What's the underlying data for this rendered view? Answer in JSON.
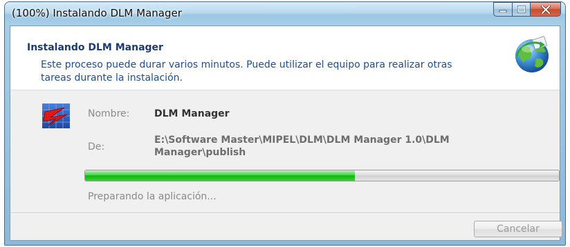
{
  "window": {
    "title": "(100%) Instalando DLM Manager"
  },
  "header": {
    "title": "Instalando DLM Manager",
    "description": "Este proceso puede durar varios minutos. Puede utilizar el equipo para realizar otras tareas durante la instalación.",
    "icon": "globe-install-icon"
  },
  "details": {
    "app_icon": "dlm-app-icon",
    "name_label": "Nombre:",
    "name_value": "DLM Manager",
    "from_label": "De:",
    "from_value": "E:\\Software Master\\MIPEL\\DLM\\DLM Manager 1.0\\DLM Manager\\publish"
  },
  "progress": {
    "fraction": 0.57,
    "status": "Preparando la aplicación..."
  },
  "actions": {
    "cancel_label": "Cancelar"
  },
  "colors": {
    "progress_fill": "#10b510",
    "header_text": "#1f4d8c",
    "close_button": "#c44d30"
  }
}
